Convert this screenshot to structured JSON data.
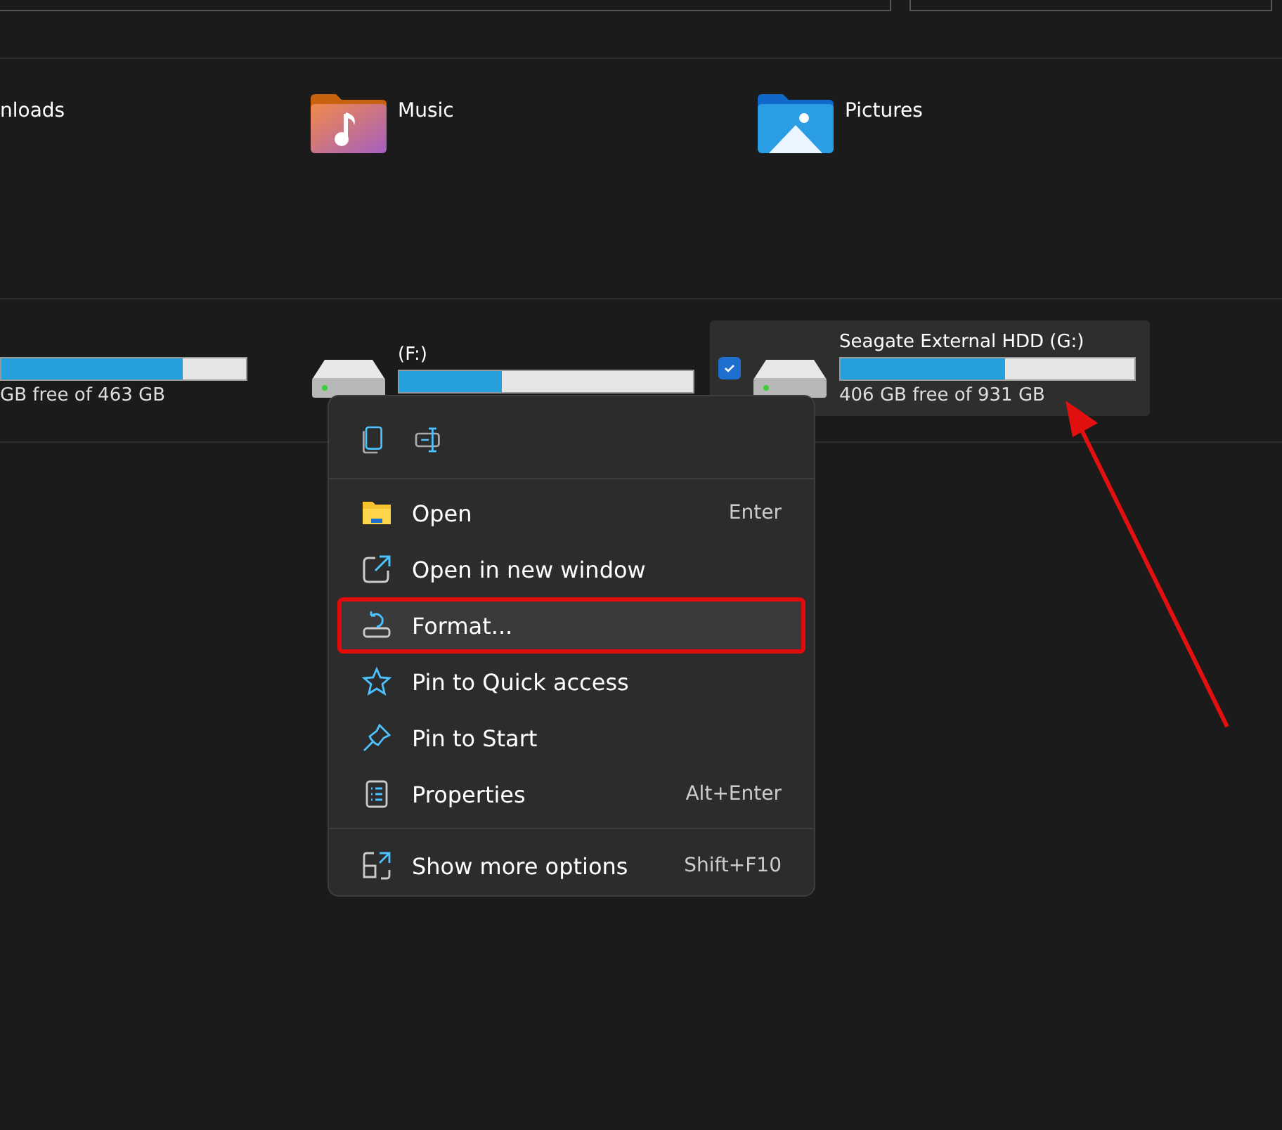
{
  "folders": [
    {
      "name": "nloads"
    },
    {
      "name": "Music"
    },
    {
      "name": "Pictures"
    }
  ],
  "drives": [
    {
      "level": 0.74,
      "free": "GB free of 463 GB",
      "selected": false
    },
    {
      "label": "(F:)",
      "level": 0.35,
      "selected": false
    },
    {
      "label": "Seagate External HDD (G:)",
      "level": 0.56,
      "free": "406 GB free of 931 GB",
      "selected": true
    }
  ],
  "context_menu": {
    "items": [
      {
        "label": "Open",
        "shortcut": "Enter",
        "selected": false,
        "outlined": false
      },
      {
        "label": "Open in new window",
        "selected": false,
        "outlined": false
      },
      {
        "label": "Format...",
        "selected": true,
        "outlined": true
      },
      {
        "label": "Pin to Quick access",
        "selected": false,
        "outlined": false
      },
      {
        "label": "Pin to Start",
        "selected": false,
        "outlined": false
      },
      {
        "label": "Properties",
        "shortcut": "Alt+Enter",
        "selected": false,
        "outlined": false
      },
      {
        "label": "Show more options",
        "shortcut": "Shift+F10",
        "selected": false,
        "outlined": false
      }
    ]
  }
}
